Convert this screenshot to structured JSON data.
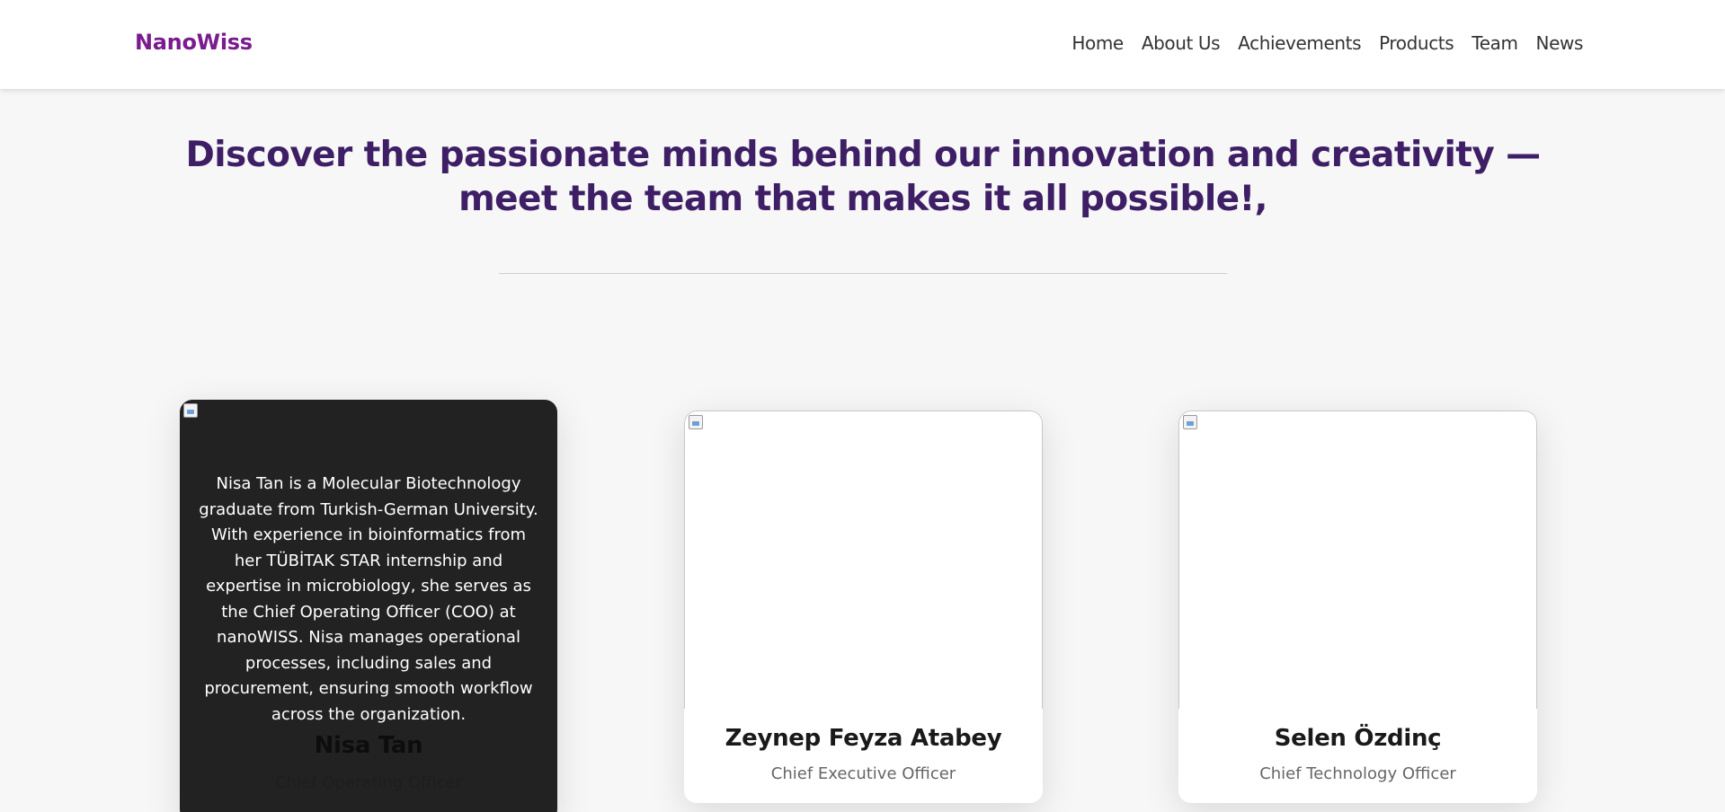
{
  "header": {
    "brand": "NanoWiss",
    "nav": [
      "Home",
      "About Us",
      "Achievements",
      "Products",
      "Team",
      "News"
    ]
  },
  "hero": {
    "title": "Discover the passionate minds behind our innovation and creativity — meet the team that makes it all possible!,"
  },
  "team": [
    {
      "name": "Nisa Tan",
      "role": "Chief Operating Officer",
      "bio": "Nisa Tan is a Molecular Biotechnology graduate from Turkish-German University. With experience in bioinformatics from her TÜBİTAK STAR internship and expertise in microbiology, she serves as the Chief Operating Officer (COO) at nanoWISS. Nisa manages operational processes, including sales and procurement, ensuring smooth workflow across the organization."
    },
    {
      "name": "Zeynep Feyza Atabey",
      "role": "Chief Executive Officer"
    },
    {
      "name": "Selen Özdinç",
      "role": "Chief Technology Officer"
    }
  ],
  "colors": {
    "brand": "#7a1b8f",
    "heading": "#3e1f66",
    "card_hover": "#222222"
  }
}
